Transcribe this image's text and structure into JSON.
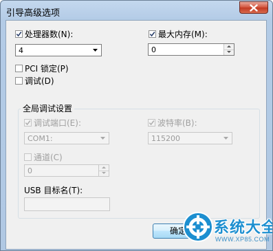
{
  "window": {
    "title": "引导高级选项"
  },
  "processors": {
    "checkbox_label": "处理器数(N):",
    "checked": true,
    "value": "4"
  },
  "max_memory": {
    "checkbox_label": "最大内存(M):",
    "checked": true,
    "value": "0"
  },
  "pci_lock": {
    "label": "PCI 锁定(P)",
    "checked": false
  },
  "debug": {
    "label": "调试(D)",
    "checked": false
  },
  "global_debug": {
    "group_title": "全局调试设置",
    "debug_port": {
      "label": "调试端口(E):",
      "checked": true,
      "value": "COM1:"
    },
    "baud_rate": {
      "label": "波特率(B):",
      "checked": true,
      "value": "115200"
    },
    "channel": {
      "label": "通道(C)",
      "checked": false,
      "value": "0"
    },
    "usb_target": {
      "label": "USB 目标名(T):",
      "value": ""
    }
  },
  "buttons": {
    "ok_label": "确定"
  },
  "watermark": {
    "text": "系统大全",
    "url": "WWW.XP85.COM"
  },
  "colors": {
    "title_bar": "#b3cbe6",
    "client_bg": "#f0f0f0",
    "close_button": "#c9442c",
    "ok_button": "#bee6fd",
    "watermark": "#1d8fd0"
  }
}
